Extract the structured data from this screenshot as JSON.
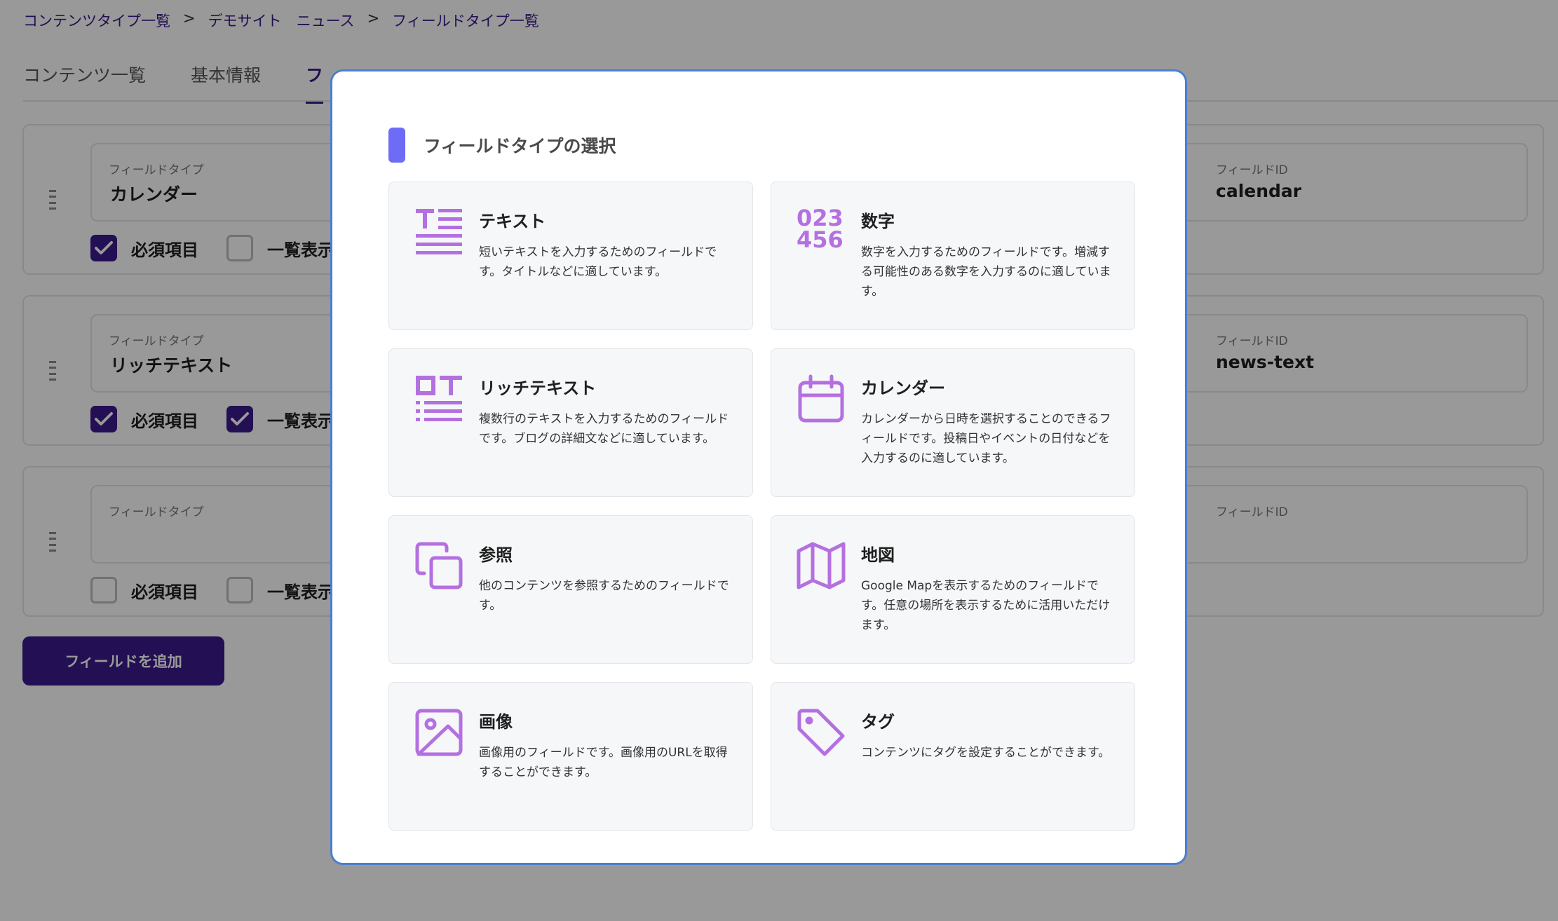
{
  "breadcrumb": {
    "items": [
      "コンテンツタイプ一覧",
      "デモサイト　ニュース",
      "フィールドタイプ一覧"
    ],
    "separator": ">"
  },
  "tabs": {
    "items": [
      "コンテンツ一覧",
      "基本情報",
      "フ"
    ]
  },
  "fields": [
    {
      "type_label": "フィールドタイプ",
      "type_value": "カレンダー",
      "id_label": "フィールドID",
      "id_value": "calendar",
      "required_label": "必須項目",
      "required": true,
      "list_label": "一覧表示",
      "list": false
    },
    {
      "type_label": "フィールドタイプ",
      "type_value": "リッチテキスト",
      "id_label": "フィールドID",
      "id_value": "news-text",
      "required_label": "必須項目",
      "required": true,
      "list_label": "一覧表示",
      "list": true
    },
    {
      "type_label": "フィールドタイプ",
      "type_value": "",
      "id_label": "フィールドID",
      "id_value": "",
      "required_label": "必須項目",
      "required": false,
      "list_label": "一覧表示",
      "list": false
    }
  ],
  "add_button": "フィールドを追加",
  "modal": {
    "title": "フィールドタイプの選択",
    "options": [
      {
        "name": "テキスト",
        "desc": "短いテキストを入力するためのフィールドです。タイトルなどに適しています。",
        "icon": "text-icon"
      },
      {
        "name": "数字",
        "desc": "数字を入力するためのフィールドです。増減する可能性のある数字を入力するのに適しています。",
        "icon": "number-icon",
        "icon_text_1": "023",
        "icon_text_2": "456"
      },
      {
        "name": "リッチテキスト",
        "desc": "複数行のテキストを入力するためのフィールドです。ブログの詳細文などに適しています。",
        "icon": "rich-text-icon"
      },
      {
        "name": "カレンダー",
        "desc": "カレンダーから日時を選択することのできるフィールドです。投稿日やイベントの日付などを入力するのに適しています。",
        "icon": "calendar-icon"
      },
      {
        "name": "参照",
        "desc": "他のコンテンツを参照するためのフィールドです。",
        "icon": "copy-icon"
      },
      {
        "name": "地図",
        "desc": "Google Mapを表示するためのフィールドです。任意の場所を表示するために活用いただけます。",
        "icon": "map-icon"
      },
      {
        "name": "画像",
        "desc": "画像用のフィールドです。画像用のURLを取得することができます。",
        "icon": "image-icon"
      },
      {
        "name": "タグ",
        "desc": "コンテンツにタグを設定することができます。",
        "icon": "tag-icon"
      }
    ]
  },
  "colors": {
    "brand": "#3b1a8a",
    "icon": "#b470e0",
    "title_bar": "#6e6cf6",
    "modal_border": "#4a7fd0"
  }
}
